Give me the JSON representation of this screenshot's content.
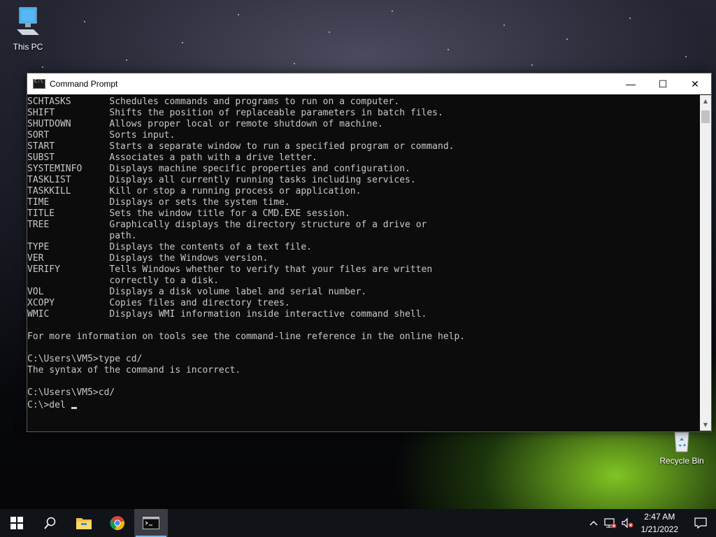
{
  "desktop": {
    "icons": [
      {
        "label": "This PC"
      },
      {
        "label": "Recycle Bin"
      }
    ]
  },
  "window": {
    "title": "Command Prompt",
    "controls": {
      "minimize": "—",
      "maximize": "☐",
      "close": "✕"
    },
    "console_lines": [
      "SCHTASKS       Schedules commands and programs to run on a computer.",
      "SHIFT          Shifts the position of replaceable parameters in batch files.",
      "SHUTDOWN       Allows proper local or remote shutdown of machine.",
      "SORT           Sorts input.",
      "START          Starts a separate window to run a specified program or command.",
      "SUBST          Associates a path with a drive letter.",
      "SYSTEMINFO     Displays machine specific properties and configuration.",
      "TASKLIST       Displays all currently running tasks including services.",
      "TASKKILL       Kill or stop a running process or application.",
      "TIME           Displays or sets the system time.",
      "TITLE          Sets the window title for a CMD.EXE session.",
      "TREE           Graphically displays the directory structure of a drive or",
      "               path.",
      "TYPE           Displays the contents of a text file.",
      "VER            Displays the Windows version.",
      "VERIFY         Tells Windows whether to verify that your files are written",
      "               correctly to a disk.",
      "VOL            Displays a disk volume label and serial number.",
      "XCOPY          Copies files and directory trees.",
      "WMIC           Displays WMI information inside interactive command shell.",
      "",
      "For more information on tools see the command-line reference in the online help.",
      "",
      "C:\\Users\\VM5>type cd/",
      "The syntax of the command is incorrect.",
      "",
      "C:\\Users\\VM5>cd/",
      ""
    ],
    "prompt_line": "C:\\>del "
  },
  "taskbar": {
    "items": [
      {
        "name": "start",
        "icon": "windows-logo-icon"
      },
      {
        "name": "search",
        "icon": "search-icon"
      },
      {
        "name": "file-explorer",
        "icon": "folder-icon"
      },
      {
        "name": "chrome",
        "icon": "chrome-icon"
      },
      {
        "name": "command-prompt",
        "icon": "cmd-icon",
        "active": true
      }
    ],
    "tray": {
      "time": "2:47 AM",
      "date": "1/21/2022"
    }
  },
  "colors": {
    "console_bg": "#0c0c0c",
    "console_text": "#c8c8c8",
    "taskbar_bg": "#101318",
    "accent": "#76b9ed"
  }
}
